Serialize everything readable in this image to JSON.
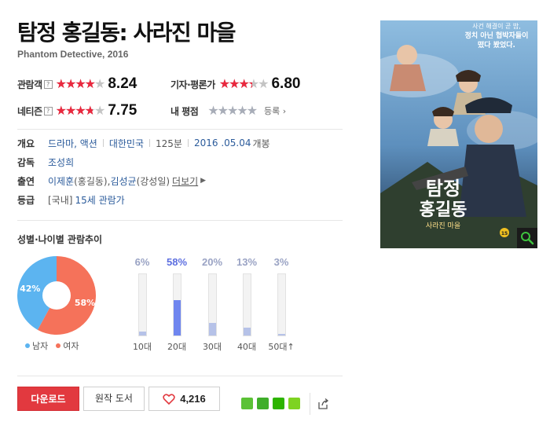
{
  "movie": {
    "title": "탐정 홍길동: 사라진 마을",
    "subtitle": "Phantom Detective, 2016"
  },
  "ratings": {
    "audience": {
      "label": "관람객",
      "score": "8.24",
      "fill_fraction": 0.824
    },
    "critics": {
      "label": "기자·평론가",
      "score": "6.80",
      "fill_fraction": 0.68
    },
    "netizen": {
      "label": "네티즌",
      "score": "7.75",
      "fill_fraction": 0.775
    },
    "mine": {
      "label": "내 평점",
      "register": "등록"
    },
    "help_glyph": "?"
  },
  "info": {
    "overview": {
      "key": "개요",
      "genre": "드라마, 액션",
      "country": "대한민국",
      "runtime": "125분",
      "release_date": "2016 .05.04",
      "release_suffix": "개봉"
    },
    "director": {
      "key": "감독",
      "name": "조성희"
    },
    "cast": {
      "key": "출연",
      "actor1": "이제훈",
      "role1": "(홍길동), ",
      "actor2": "김성균",
      "role2": "(강성일)",
      "more": "더보기"
    },
    "rating": {
      "key": "등급",
      "domestic": "[국내]",
      "grade": "15세 관람가"
    }
  },
  "stats": {
    "title": "성별·나이별 관람추이",
    "legend_male": "남자",
    "legend_female": "여자",
    "male_color": "#5cb4f0",
    "female_color": "#f5725a"
  },
  "chart_data": {
    "type": "bar",
    "gender": {
      "labels": [
        "남자",
        "여자"
      ],
      "values": [
        42,
        58
      ],
      "value_labels": [
        "42%",
        "58%"
      ]
    },
    "categories": [
      "10대",
      "20대",
      "30대",
      "40대",
      "50대↑"
    ],
    "values": [
      6,
      58,
      20,
      13,
      3
    ],
    "value_labels": [
      "6%",
      "58%",
      "20%",
      "13%",
      "3%"
    ],
    "highlight_index": 1,
    "ylim": [
      0,
      100
    ]
  },
  "actions": {
    "download_label": "다운로드",
    "book_label": "원작 도서",
    "like_count": "4,216"
  },
  "poster": {
    "title_line1": "탐정",
    "title_line2": "홍길동",
    "title_line3": "사라진 마을",
    "tagline_line1": "사건 해결이 곧 밥,",
    "tagline_line2": "정치 아닌 협박자들이",
    "tagline_line3": "떴다 봤었다.",
    "rating_badge": "15"
  },
  "colors": {
    "accent_red": "#e2393f",
    "star_red": "#e9283e",
    "link_blue": "#2b5b9b",
    "bar_highlight": "#6f86ef"
  }
}
